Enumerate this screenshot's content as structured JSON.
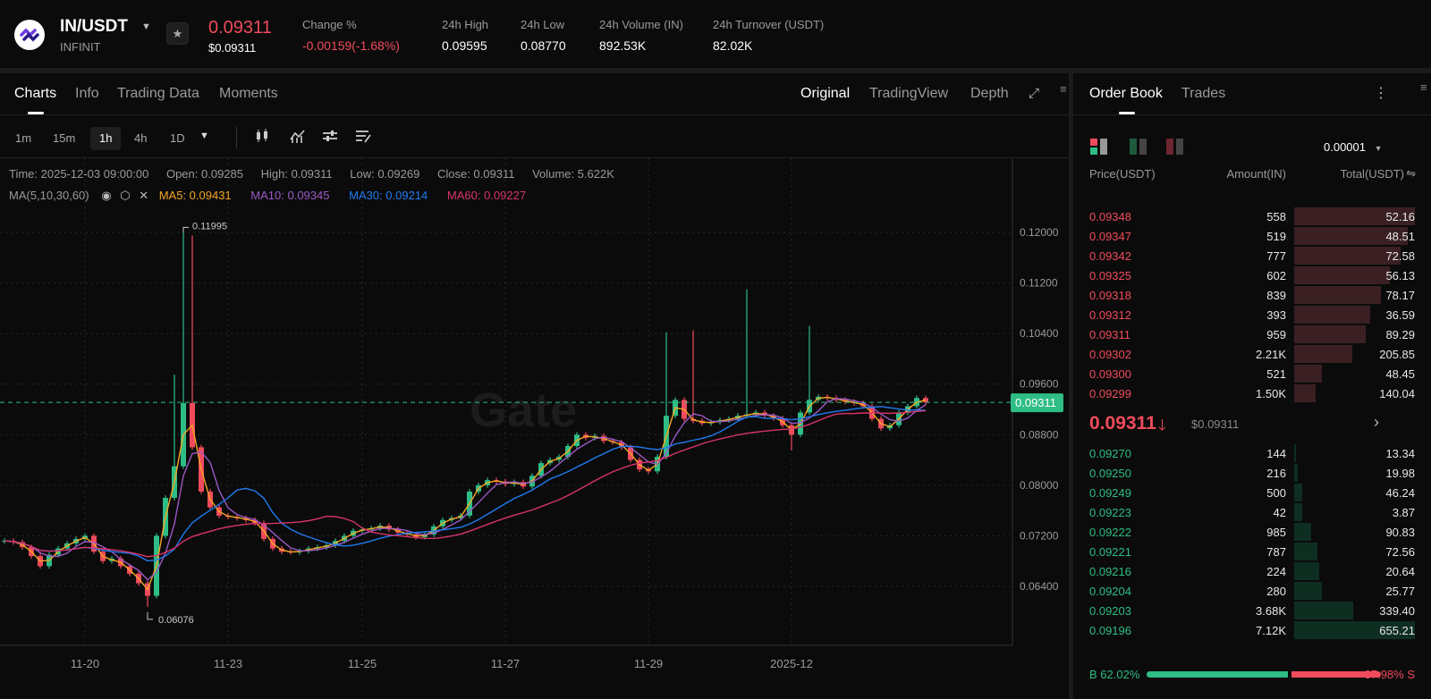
{
  "header": {
    "pair": "IN/USDT",
    "token_name": "INFINIT",
    "last_price": "0.09311",
    "last_price_usd": "$0.09311",
    "stats": [
      {
        "label": "Change %",
        "value": "-0.00159(-1.68%)",
        "color": "#f04b5c"
      },
      {
        "label": "24h High",
        "value": "0.09595"
      },
      {
        "label": "24h Low",
        "value": "0.08770"
      },
      {
        "label": "24h Volume (IN)",
        "value": "892.53K"
      },
      {
        "label": "24h Turnover (USDT)",
        "value": "82.02K"
      }
    ]
  },
  "chart_tabs": [
    "Charts",
    "Info",
    "Trading Data",
    "Moments"
  ],
  "view_tabs": [
    "Original",
    "TradingView",
    "Depth"
  ],
  "timeframes": [
    "1m",
    "15m",
    "1h",
    "4h",
    "1D"
  ],
  "selected_timeframe": "1h",
  "ohlc_info": {
    "time": "Time: 2025-12-03 09:00:00",
    "open": "Open: 0.09285",
    "high": "High: 0.09311",
    "low": "Low: 0.09269",
    "close": "Close: 0.09311",
    "volume": "Volume: 5.622K"
  },
  "ma_info": {
    "label": "MA(5,10,30,60)",
    "ma5": "MA5: 0.09431",
    "ma10": "MA10: 0.09345",
    "ma30": "MA30: 0.09214",
    "ma60": "MA60: 0.09227"
  },
  "colors": {
    "up": "#2ebd85",
    "down": "#f04b5c",
    "ma5": "#f5a623",
    "ma10": "#9b59c6",
    "ma30": "#1f7bef",
    "ma60": "#d9336d"
  },
  "chart_data": {
    "type": "candlestick",
    "watermark": "Gate",
    "y_ticks": [
      "0.12000",
      "0.11200",
      "0.10400",
      "0.09600",
      "0.08800",
      "0.08000",
      "0.07200",
      "0.06400"
    ],
    "ylim": [
      0.056,
      0.1284
    ],
    "x_ticks": [
      {
        "label": "11-20",
        "index": 9
      },
      {
        "label": "11-23",
        "index": 25
      },
      {
        "label": "11-25",
        "index": 40
      },
      {
        "label": "11-27",
        "index": 56
      },
      {
        "label": "11-29",
        "index": 72
      },
      {
        "label": "2025-12",
        "index": 88
      }
    ],
    "closes": [
      0.0712,
      0.071,
      0.0702,
      0.0688,
      0.0672,
      0.069,
      0.07,
      0.0708,
      0.0715,
      0.072,
      0.0695,
      0.068,
      0.0684,
      0.0672,
      0.066,
      0.0645,
      0.0625,
      0.072,
      0.078,
      0.083,
      0.093,
      0.086,
      0.079,
      0.0765,
      0.0752,
      0.075,
      0.0748,
      0.0745,
      0.074,
      0.0715,
      0.07,
      0.0695,
      0.0694,
      0.0696,
      0.07,
      0.0702,
      0.0705,
      0.0712,
      0.072,
      0.0728,
      0.073,
      0.0732,
      0.0736,
      0.073,
      0.0725,
      0.0722,
      0.0718,
      0.0722,
      0.0735,
      0.0745,
      0.0748,
      0.0752,
      0.079,
      0.08,
      0.0808,
      0.0806,
      0.0802,
      0.0805,
      0.0798,
      0.0815,
      0.0835,
      0.084,
      0.0845,
      0.0862,
      0.088,
      0.0875,
      0.0878,
      0.087,
      0.0868,
      0.086,
      0.084,
      0.0825,
      0.0822,
      0.0845,
      0.091,
      0.0935,
      0.0905,
      0.0902,
      0.0898,
      0.09,
      0.0903,
      0.0905,
      0.091,
      0.0912,
      0.0915,
      0.091,
      0.0906,
      0.0895,
      0.088,
      0.0915,
      0.0935,
      0.094,
      0.0938,
      0.0935,
      0.0932,
      0.093,
      0.0925,
      0.0905,
      0.089,
      0.0895,
      0.0915,
      0.0925,
      0.0938,
      0.09311
    ],
    "high_overrides": {
      "19": 0.0975,
      "20": 0.11995,
      "21": 0.1195,
      "74": 0.1042,
      "77": 0.1045,
      "83": 0.111,
      "90": 0.1052
    },
    "low_overrides": {
      "16": 0.06076,
      "88": 0.0855
    },
    "max_label": "0.11995",
    "min_label": "0.06076",
    "current_price": 0.09311,
    "current_price_label": "0.09311",
    "ma_windows_in_candles": [
      2,
      4,
      10,
      20
    ]
  },
  "orderbook": {
    "tabs": [
      "Order Book",
      "Trades"
    ],
    "precision": "0.00001",
    "headers": [
      "Price(USDT)",
      "Amount(IN)",
      "Total(USDT)"
    ],
    "asks": [
      {
        "price": "0.09348",
        "amount": "558",
        "total": "52.16",
        "depth": 1.0
      },
      {
        "price": "0.09347",
        "amount": "519",
        "total": "48.51",
        "depth": 0.94
      },
      {
        "price": "0.09342",
        "amount": "777",
        "total": "72.58",
        "depth": 0.88
      },
      {
        "price": "0.09325",
        "amount": "602",
        "total": "56.13",
        "depth": 0.79
      },
      {
        "price": "0.09318",
        "amount": "839",
        "total": "78.17",
        "depth": 0.72
      },
      {
        "price": "0.09312",
        "amount": "393",
        "total": "36.59",
        "depth": 0.63
      },
      {
        "price": "0.09311",
        "amount": "959",
        "total": "89.29",
        "depth": 0.59
      },
      {
        "price": "0.09302",
        "amount": "2.21K",
        "total": "205.85",
        "depth": 0.48
      },
      {
        "price": "0.09300",
        "amount": "521",
        "total": "48.45",
        "depth": 0.23
      },
      {
        "price": "0.09299",
        "amount": "1.50K",
        "total": "140.04",
        "depth": 0.18
      }
    ],
    "mid_price": "0.09311",
    "mid_price_usd": "$0.09311",
    "bids": [
      {
        "price": "0.09270",
        "amount": "144",
        "total": "13.34",
        "depth": 0.015
      },
      {
        "price": "0.09250",
        "amount": "216",
        "total": "19.98",
        "depth": 0.03
      },
      {
        "price": "0.09249",
        "amount": "500",
        "total": "46.24",
        "depth": 0.07
      },
      {
        "price": "0.09223",
        "amount": "42",
        "total": "3.87",
        "depth": 0.07
      },
      {
        "price": "0.09222",
        "amount": "985",
        "total": "90.83",
        "depth": 0.14
      },
      {
        "price": "0.09221",
        "amount": "787",
        "total": "72.56",
        "depth": 0.195
      },
      {
        "price": "0.09216",
        "amount": "224",
        "total": "20.64",
        "depth": 0.21
      },
      {
        "price": "0.09204",
        "amount": "280",
        "total": "25.77",
        "depth": 0.23
      },
      {
        "price": "0.09203",
        "amount": "3.68K",
        "total": "339.40",
        "depth": 0.49
      },
      {
        "price": "0.09196",
        "amount": "7.12K",
        "total": "655.21",
        "depth": 1.0
      }
    ],
    "buy_label": "B 62.02%",
    "sell_label": "37.98% S",
    "buy_ratio": 0.6202
  }
}
